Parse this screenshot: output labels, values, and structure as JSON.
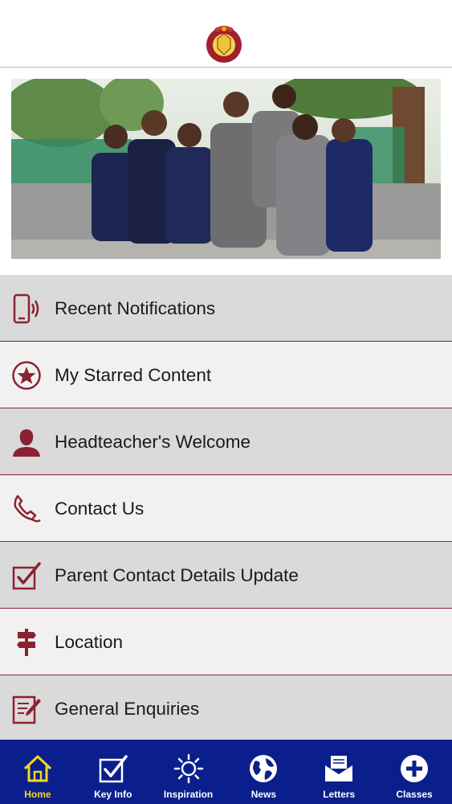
{
  "header": {
    "logo": "school-crest-logo"
  },
  "hero": {
    "image": "school-children-group-photo"
  },
  "menu": {
    "items": [
      {
        "label": "Recent Notifications",
        "icon": "phone-notification-icon"
      },
      {
        "label": "My Starred Content",
        "icon": "star-circle-icon"
      },
      {
        "label": "Headteacher's Welcome",
        "icon": "person-icon"
      },
      {
        "label": "Contact Us",
        "icon": "phone-handset-icon"
      },
      {
        "label": "Parent Contact Details Update",
        "icon": "checkbox-icon"
      },
      {
        "label": "Location",
        "icon": "signpost-icon"
      },
      {
        "label": "General Enquiries",
        "icon": "document-edit-icon"
      }
    ]
  },
  "tabbar": {
    "tabs": [
      {
        "label": "Home",
        "icon": "home-icon",
        "active": true
      },
      {
        "label": "Key Info",
        "icon": "checkbox-icon",
        "active": false
      },
      {
        "label": "Inspiration",
        "icon": "sun-icon",
        "active": false
      },
      {
        "label": "News",
        "icon": "globe-icon",
        "active": false
      },
      {
        "label": "Letters",
        "icon": "envelope-icon",
        "active": false
      },
      {
        "label": "Classes",
        "icon": "plus-circle-icon",
        "active": false
      }
    ]
  },
  "colors": {
    "accent": "#8a2232",
    "tabbar": "#0b1f8c",
    "active_tab": "#f4d81c",
    "menu_shade": "#dadada",
    "menu_light": "#f1f1f1"
  }
}
